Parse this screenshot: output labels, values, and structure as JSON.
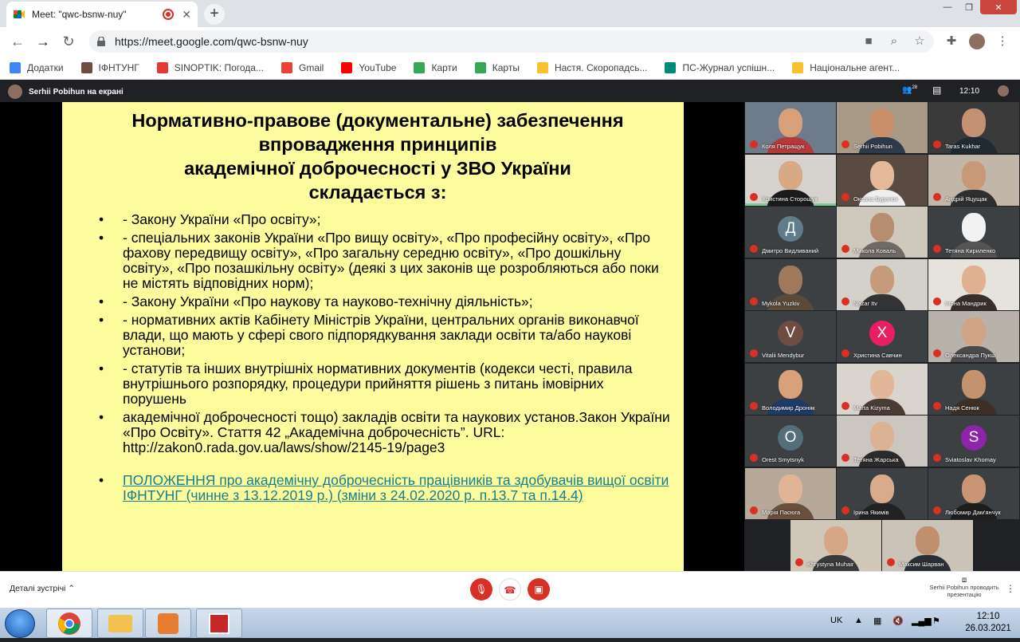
{
  "browser": {
    "tab_title": "Meet: \"qwc-bsnw-nuy\"",
    "tab_close": "✕",
    "new_tab": "+",
    "url": "https://meet.google.com/qwc-bsnw-nuy",
    "window_controls": [
      "—",
      "❐",
      "✕"
    ]
  },
  "bookmarks": [
    {
      "label": "Додатки",
      "color": "#4285f4",
      "icon": "apps-icon"
    },
    {
      "label": "ІФНТУНГ",
      "color": "#6d4c41",
      "icon": "university-icon"
    },
    {
      "label": "SINOPTIK: Погода...",
      "color": "#e53935",
      "icon": "thermometer-icon"
    },
    {
      "label": "Gmail",
      "color": "#ea4335",
      "icon": "gmail-icon"
    },
    {
      "label": "YouTube",
      "color": "#ff0000",
      "icon": "youtube-icon"
    },
    {
      "label": "Карти",
      "color": "#34a853",
      "icon": "maps-icon"
    },
    {
      "label": "Карты",
      "color": "#34a853",
      "icon": "maps-icon"
    },
    {
      "label": "Настя. Скоропадсь...",
      "color": "#fbc02d",
      "icon": "folder-icon"
    },
    {
      "label": "ПС-Журнал успішн...",
      "color": "#00897b",
      "icon": "sheet-icon"
    },
    {
      "label": "Національне агент...",
      "color": "#fbc02d",
      "icon": "trident-icon"
    }
  ],
  "meet": {
    "presenter_label": "Serhii Pobihun на екрані",
    "participant_count": "28",
    "time": "12:10",
    "details": "Деталі зустрічі",
    "presenting_note": "Serhii Pobihun проводить презентацію"
  },
  "slide": {
    "title": "Нормативно-правове (документальне) забезпечення впровадження принципів академічної доброчесності у ЗВО України складається з:",
    "title_lines": [
      "Нормативно-правове (документальне) забезпечення",
      "впровадження принципів",
      "академічної доброчесності у ЗВО України",
      "складається з:"
    ],
    "items": [
      "-  Закону України «Про освіту»;",
      "-  спеціальних законів України «Про вищу освіту», «Про професійну освіту», «Про фахову передвищу освіту», «Про загальну середню освіту», «Про дошкільну освіту», «Про позашкільну освіту» (деякі з цих законів ще розробляються або поки не містять відповідних норм);",
      "-  Закону України «Про наукову та науково-технічну діяльність»;",
      "-  нормативних актів Кабінету Міністрів України, центральних органів виконавчої влади, що мають у сфері свого підпорядкування заклади освіти та/або наукові установи;",
      "-  статутів та інших внутрішніх нормативних документів (кодекси честі, правила внутрішнього розпорядку, процедури прийняття рішень з питань імовірних порушень",
      "академічної доброчесності тощо) закладів освіти та наукових установ.Закон України «Про Освіту». Стаття 42 „Академічна доброчесність”. URL: http://zakon0.rada.gov.ua/laws/show/2145-19/page3"
    ],
    "link": "ПОЛОЖЕННЯ про академічну доброчесність працівників та здобувачів вищої освіти ІФНТУНГ (чинне з 13.12.2019 р.) (зміни з 24.02.2020 р. п.13.7 та п.14.4)"
  },
  "participants": [
    {
      "name": "Коля Петращук",
      "bg": "#6d7b8a",
      "skin": "#d9a07c",
      "shirt": "#b23a3a"
    },
    {
      "name": "Serhii Pobihun",
      "bg": "#a89a86",
      "skin": "#c98f6b",
      "shirt": "#2e3a4a"
    },
    {
      "name": "Taras Kukhar",
      "bg": "#3a3a3a",
      "skin": "#c49176",
      "shirt": "#1f2a33"
    },
    {
      "name": "Христина Сторощук",
      "bg": "#d6d3cf",
      "skin": "#d8a987",
      "shirt": "#1b1b1b"
    },
    {
      "name": "Оксана Бурачок",
      "bg": "#5a4b42",
      "skin": "#e4b99a",
      "shirt": "#efefef"
    },
    {
      "name": "Андрій Яцущак",
      "bg": "#c2b6a8",
      "skin": "#c89878",
      "shirt": "#2f2f2f"
    },
    {
      "name": "Дмитро Видливаний",
      "letter": "Д",
      "bg": "#3c4043",
      "circle": "#607d8b"
    },
    {
      "name": "Микола Коваль",
      "bg": "#cfc8bd",
      "skin": "#b68d70",
      "shirt": "#6f6a63"
    },
    {
      "name": "Тетяна Кириленко",
      "bg": "#3c4043",
      "skin": "#f2f2f2",
      "shirt": "#555"
    },
    {
      "name": "Mykola Yuzkiv",
      "bg": "#3c4043",
      "skin": "#a0785c",
      "shirt": "#5a4a3a"
    },
    {
      "name": "Nazar Itv",
      "bg": "#d4d0ca",
      "skin": "#c69b7b",
      "shirt": "#333"
    },
    {
      "name": "Ілона Мандрик",
      "bg": "#e6e2dc",
      "skin": "#e0b091",
      "shirt": "#3a2e2a"
    },
    {
      "name": "Vitalii Mendybur",
      "letter": "V",
      "bg": "#3c4043",
      "circle": "#6d4c41"
    },
    {
      "name": "Христина Савчин",
      "letter": "Х",
      "bg": "#3c4043",
      "circle": "#e91e63"
    },
    {
      "name": "Олександра Пукш",
      "bg": "#b9b2aa",
      "skin": "#cfa486",
      "shirt": "#4a4a4a"
    },
    {
      "name": "Володимир Дроняк",
      "bg": "#3c4043",
      "skin": "#d9a07c",
      "shirt": "#1f3a66"
    },
    {
      "name": "Marta Kizyma",
      "bg": "#d9d4cd",
      "skin": "#e2b698",
      "shirt": "#4a3c35"
    },
    {
      "name": "Надя Сенюк",
      "bg": "#3c4043",
      "skin": "#c4926f",
      "shirt": "#3d2f26"
    },
    {
      "name": "Orest Smytsnyk",
      "letter": "O",
      "bg": "#3c4043",
      "circle": "#546e7a"
    },
    {
      "name": "Тетяна Жарська",
      "bg": "#cbc6bf",
      "skin": "#dcb295",
      "shirt": "#2b2b2b"
    },
    {
      "name": "Sviatoslav Khomay",
      "letter": "S",
      "bg": "#3c4043",
      "circle": "#8e24aa"
    },
    {
      "name": "Марія Пасюга",
      "bg": "#b7a99a",
      "skin": "#e1b497",
      "shirt": "#6a4f3d"
    },
    {
      "name": "Ірина Якимів",
      "bg": "#3c4043",
      "skin": "#d8ab8c",
      "shirt": "#222"
    },
    {
      "name": "Любомир Дам'янчук",
      "bg": "#3c4043",
      "skin": "#c99574",
      "shirt": "#1e1e1e"
    },
    {
      "name": "Khrystyna Muhair",
      "bg": "#d0c7b8",
      "skin": "#d6a686",
      "shirt": "#3a3a3a"
    },
    {
      "name": "Максим Шарван",
      "bg": "#cbc3b7",
      "skin": "#c0906e",
      "shirt": "#2a2f36"
    }
  ],
  "taskbar": {
    "lang": "UK",
    "time": "12:10",
    "date": "26.03.2021"
  }
}
